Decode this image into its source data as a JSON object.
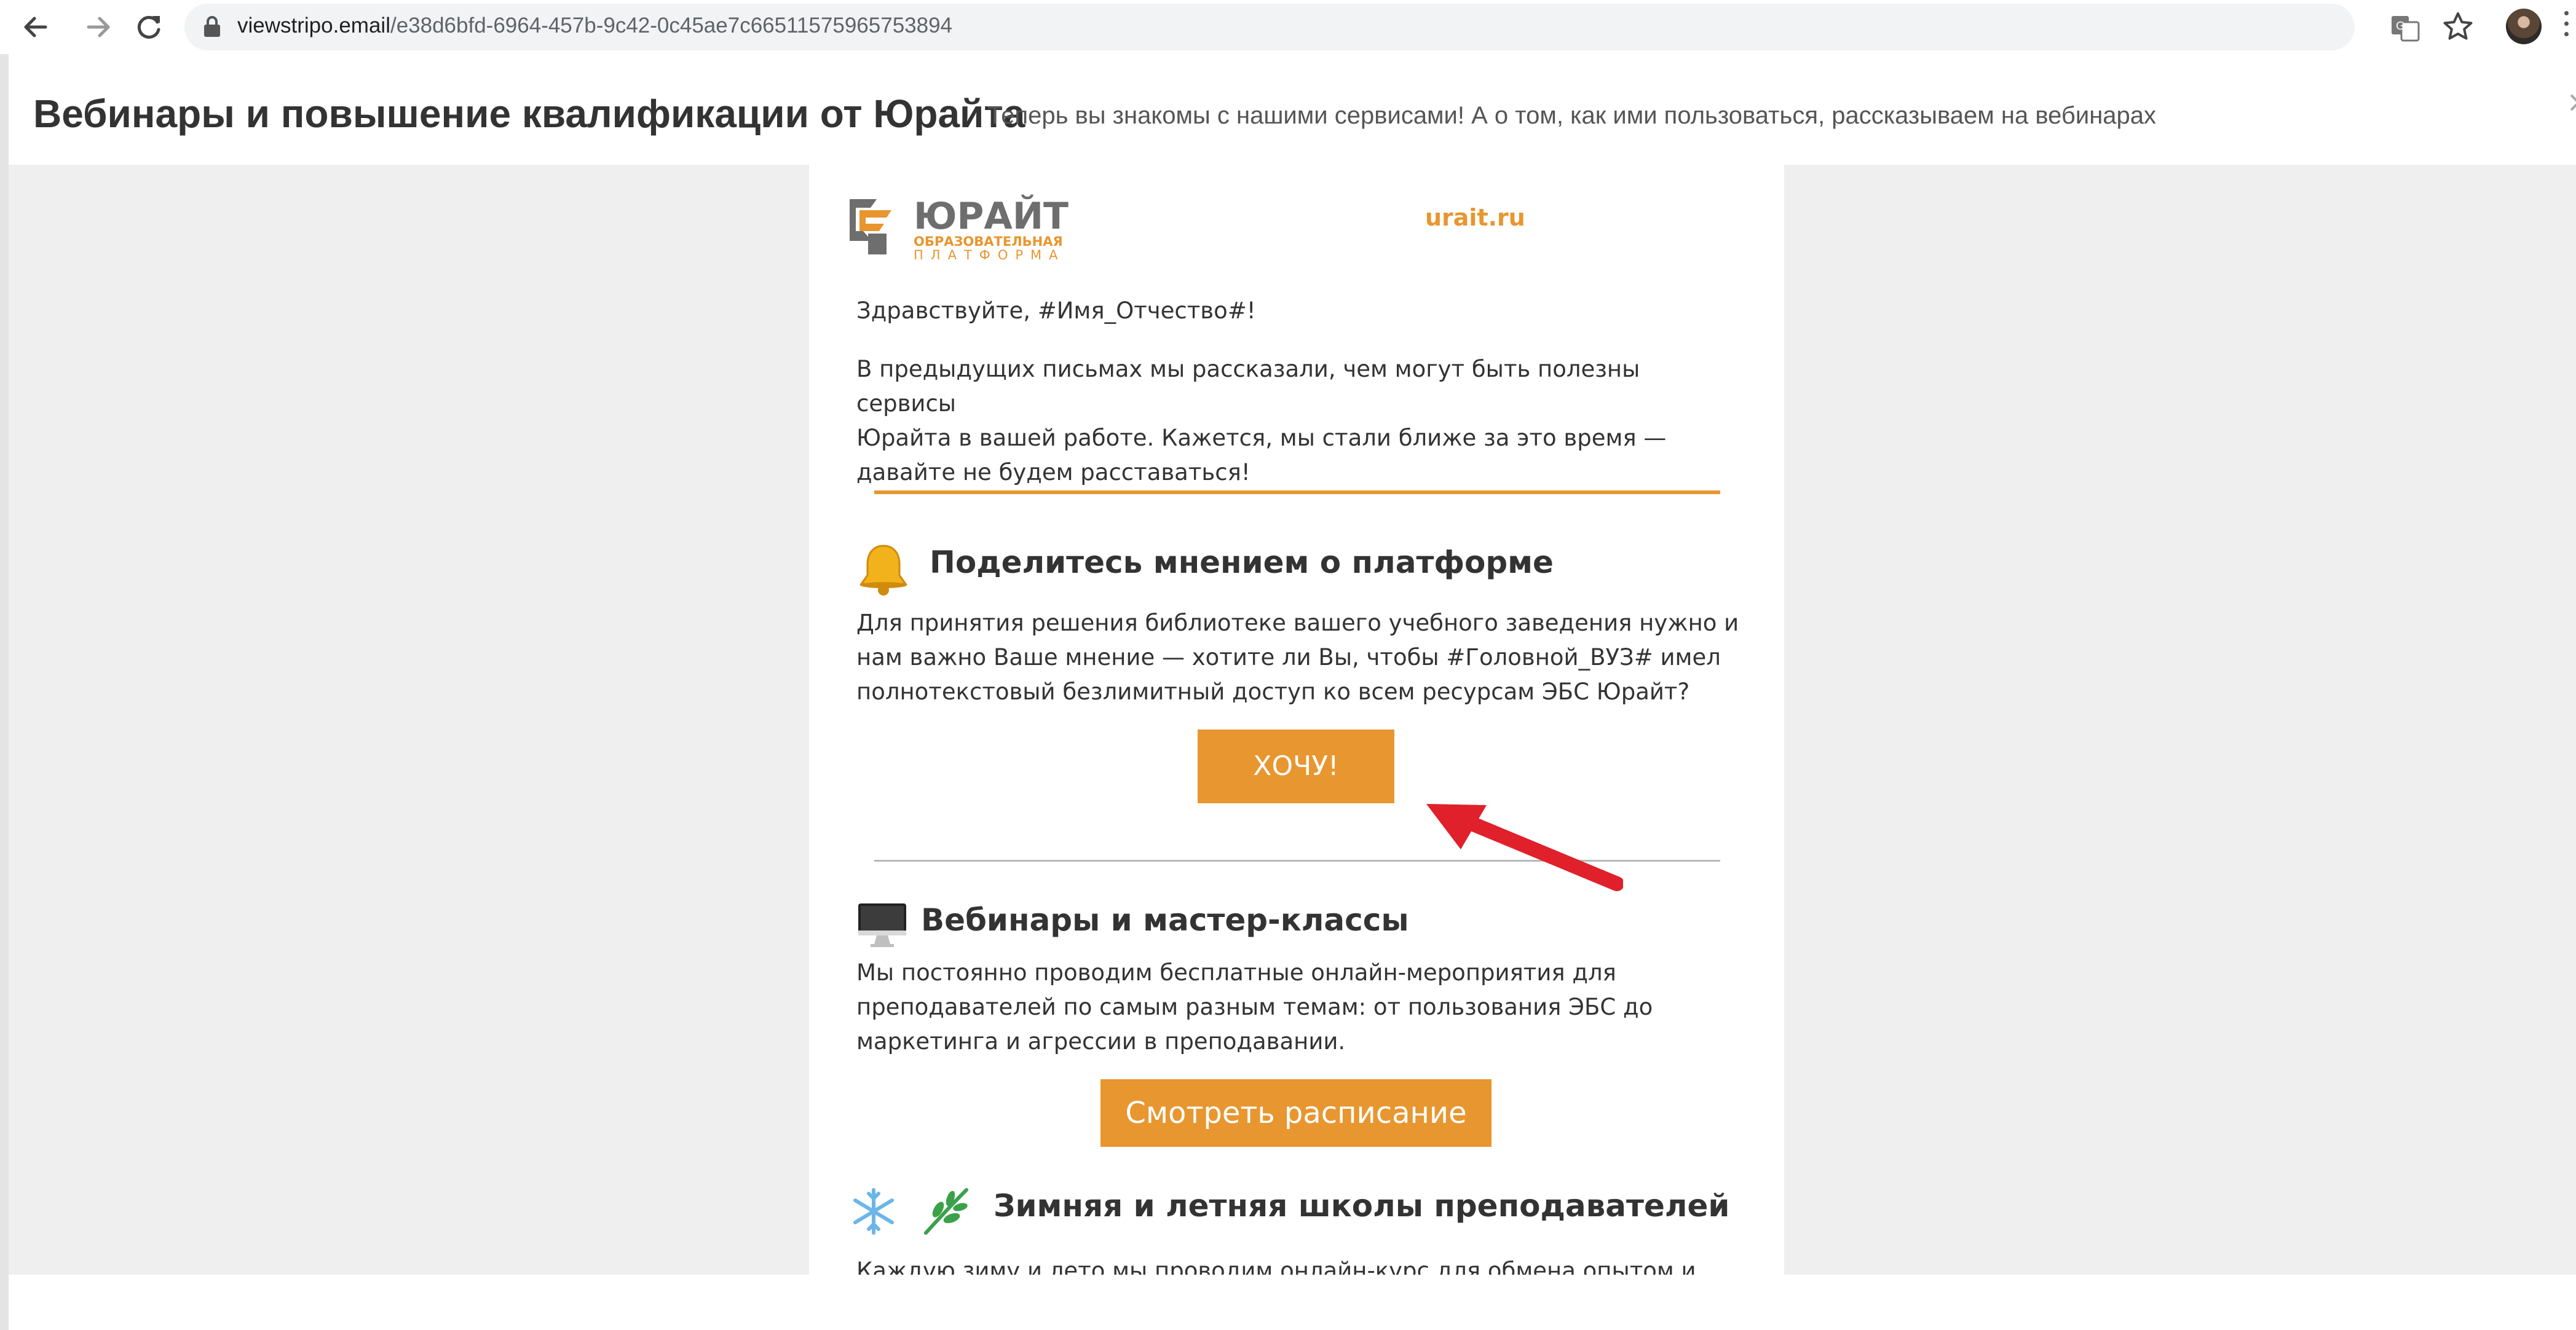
{
  "browser": {
    "url_host": "viewstripo.email",
    "url_path": "/e38d6bfd-6964-457b-9c42-0c45ae7c66511575965753894",
    "icons": [
      "back-arrow-icon",
      "forward-arrow-icon",
      "reload-icon",
      "lock-icon",
      "translate-icon",
      "star-icon",
      "avatar",
      "menu-icon"
    ]
  },
  "page_header": {
    "title": "Вебинары и повышение квалификации от Юрайта",
    "subtitle": "Теперь вы знакомы с нашими сервисами! А о том, как ими пользоваться, рассказываем на вебинарах",
    "close_symbol": "×"
  },
  "email": {
    "logo": {
      "word": "ЮРАЙТ",
      "line1": "ОБРАЗОВАТЕЛЬНАЯ",
      "line2": "ПЛАТФОРМА"
    },
    "site_link": "urait.ru",
    "greeting": "Здравствуйте, #Имя_Отчество#!",
    "intro": [
      "В предыдущих письмах мы рассказали, чем могут быть полезны сервисы",
      "Юрайта в вашей работе. Кажется, мы стали ближе за это время —",
      "давайте не будем расставаться!"
    ],
    "section1": {
      "icon": "bell-icon",
      "title": "Поделитесь мнением о платформе",
      "text": [
        "Для принятия решения библиотеке вашего учебного заведения нужно и",
        "нам важно Ваше мнение — хотите ли Вы, чтобы #Головной_ВУЗ# имел",
        "полнотекстовый безлимитный доступ ко всем ресурсам ЭБС Юрайт?"
      ],
      "button": "ХОЧУ!"
    },
    "section2": {
      "icon": "desktop-computer-icon",
      "title": "Вебинары и мастер-классы",
      "text": [
        "Мы постоянно проводим бесплатные онлайн-мероприятия для",
        "преподавателей по самым разным темам: от пользования ЭБС до",
        "маркетинга и агрессии в преподавании."
      ],
      "button": "Смотреть расписание"
    },
    "section3": {
      "icons": [
        "snowflake-icon",
        "herb-icon"
      ],
      "title": "Зимняя и летняя школы преподавателей",
      "text_cut": "Каждую зиму и лето мы проводим онлайн-курс для обмена опытом и"
    }
  },
  "colors": {
    "accent": "#e8962f",
    "annotation": "#e0202a",
    "backdrop": "#efefef"
  }
}
